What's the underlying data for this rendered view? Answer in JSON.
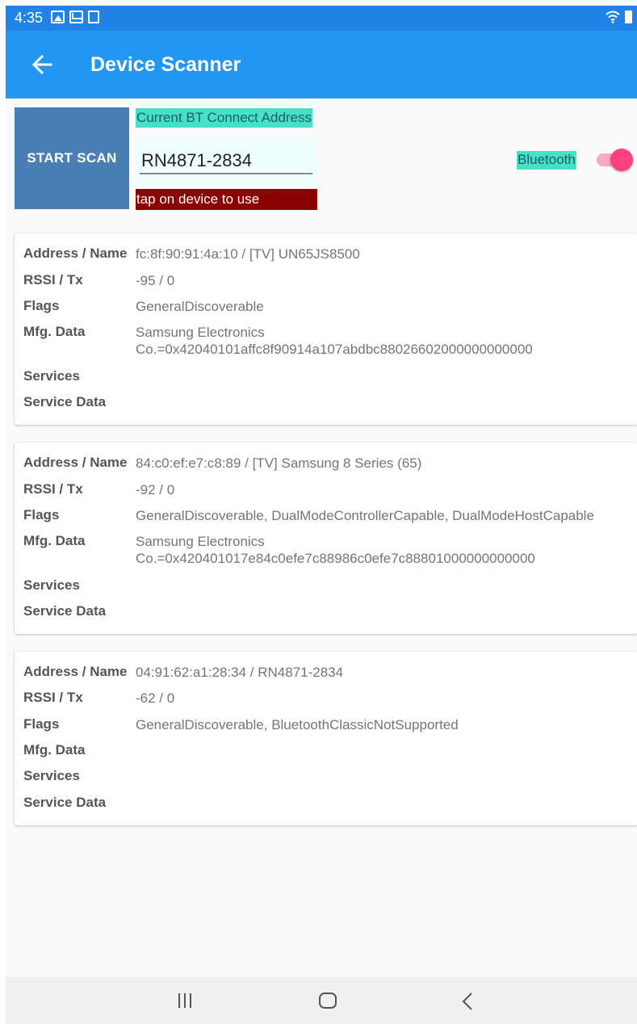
{
  "status_bar": {
    "time": "4:35",
    "icons": [
      "photo-icon",
      "mail-icon",
      "screenshot-icon",
      "wifi-icon",
      "battery-icon"
    ]
  },
  "app_bar": {
    "title": "Device Scanner",
    "back_icon": "arrow-left-icon"
  },
  "controls": {
    "start_scan_label": "START SCAN",
    "current_address_label": "Current BT Connect Address",
    "current_address_value": "RN4871-2834",
    "tap_hint": "tap on device to use",
    "bluetooth_label": "Bluetooth",
    "bluetooth_enabled": true
  },
  "field_labels": {
    "address": "Address / Name",
    "rssi": "RSSI / Tx",
    "flags": "Flags",
    "mfg": "Mfg. Data",
    "services": "Services",
    "service_data": "Service Data"
  },
  "devices": [
    {
      "address_name": "fc:8f:90:91:4a:10 / [TV] UN65JS8500",
      "rssi_tx": "-95 / 0",
      "flags": "GeneralDiscoverable",
      "mfg_data": "Samsung Electronics Co.=0x42040101affc8f90914a107abdbc88026602000000000000",
      "services": "",
      "service_data": ""
    },
    {
      "address_name": "84:c0:ef:e7:c8:89 / [TV] Samsung 8 Series (65)",
      "rssi_tx": "-92 / 0",
      "flags": "GeneralDiscoverable, DualModeControllerCapable, DualModeHostCapable",
      "mfg_data": "Samsung Electronics Co.=0x420401017e84c0efe7c88986c0efe7c88801000000000000",
      "services": "",
      "service_data": ""
    },
    {
      "address_name": "04:91:62:a1:28:34 / RN4871-2834",
      "rssi_tx": "-62 / 0",
      "flags": "GeneralDiscoverable, BluetoothClassicNotSupported",
      "mfg_data": "",
      "services": "",
      "service_data": ""
    }
  ],
  "nav_bar": {
    "icons": [
      "recent-apps-icon",
      "home-icon",
      "back-icon"
    ]
  },
  "colors": {
    "status_bar": "#1f84e6",
    "app_bar": "#2196f3",
    "start_scan": "#4a7fb5",
    "label_highlight": "#46e1c4",
    "hint_background": "#8b0000",
    "toggle_accent": "#ff4081"
  }
}
